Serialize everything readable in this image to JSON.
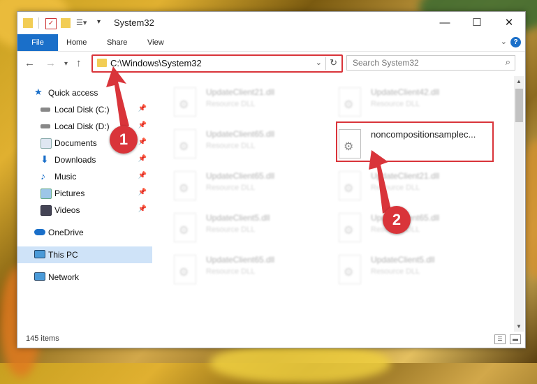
{
  "window": {
    "title": "System32",
    "controls": {
      "minimize": "—",
      "maximize": "☐",
      "close": "✕"
    }
  },
  "ribbon": {
    "tabs": [
      "File",
      "Home",
      "Share",
      "View"
    ],
    "help": "?"
  },
  "address": {
    "path": "C:\\Windows\\System32",
    "search_placeholder": "Search System32"
  },
  "nav_pane": {
    "items": [
      {
        "label": "Quick access",
        "icon": "star-icon"
      },
      {
        "label": "Local Disk (C:)",
        "icon": "drive-icon"
      },
      {
        "label": "Local Disk (D:)",
        "icon": "drive-icon"
      },
      {
        "label": "Documents",
        "icon": "documents-icon"
      },
      {
        "label": "Downloads",
        "icon": "downloads-icon"
      },
      {
        "label": "Music",
        "icon": "music-icon"
      },
      {
        "label": "Pictures",
        "icon": "pictures-icon"
      },
      {
        "label": "Videos",
        "icon": "videos-icon"
      },
      {
        "label": "OneDrive",
        "icon": "cloud-icon"
      },
      {
        "label": "This PC",
        "icon": "computer-icon"
      },
      {
        "label": "Network",
        "icon": "network-icon"
      }
    ]
  },
  "files": [
    {
      "name": "UpdateClient21.dll",
      "type": "Resource DLL"
    },
    {
      "name": "UpdateClient42.dll",
      "type": "Resource DLL"
    },
    {
      "name": "UpdateClient65.dll",
      "type": "Resource DLL"
    },
    {
      "name": "noncompositionsamplec...",
      "type": ""
    },
    {
      "name": "UpdateClient65.dll",
      "type": "Resource DLL"
    },
    {
      "name": "UpdateClient21.dll",
      "type": "Resource DLL"
    },
    {
      "name": "UpdateClient5.dll",
      "type": "Resource DLL"
    },
    {
      "name": "UpdateClient65.dll",
      "type": "Resource DLL"
    },
    {
      "name": "UpdateClient65.dll",
      "type": "Resource DLL"
    },
    {
      "name": "UpdateClient5.dll",
      "type": "Resource DLL"
    }
  ],
  "status": {
    "count": "145 items"
  },
  "annotations": {
    "badge1": "1",
    "badge2": "2"
  },
  "colors": {
    "accent": "#1a6fc9",
    "highlight": "#d9343a",
    "selected": "#cfe3f8"
  }
}
